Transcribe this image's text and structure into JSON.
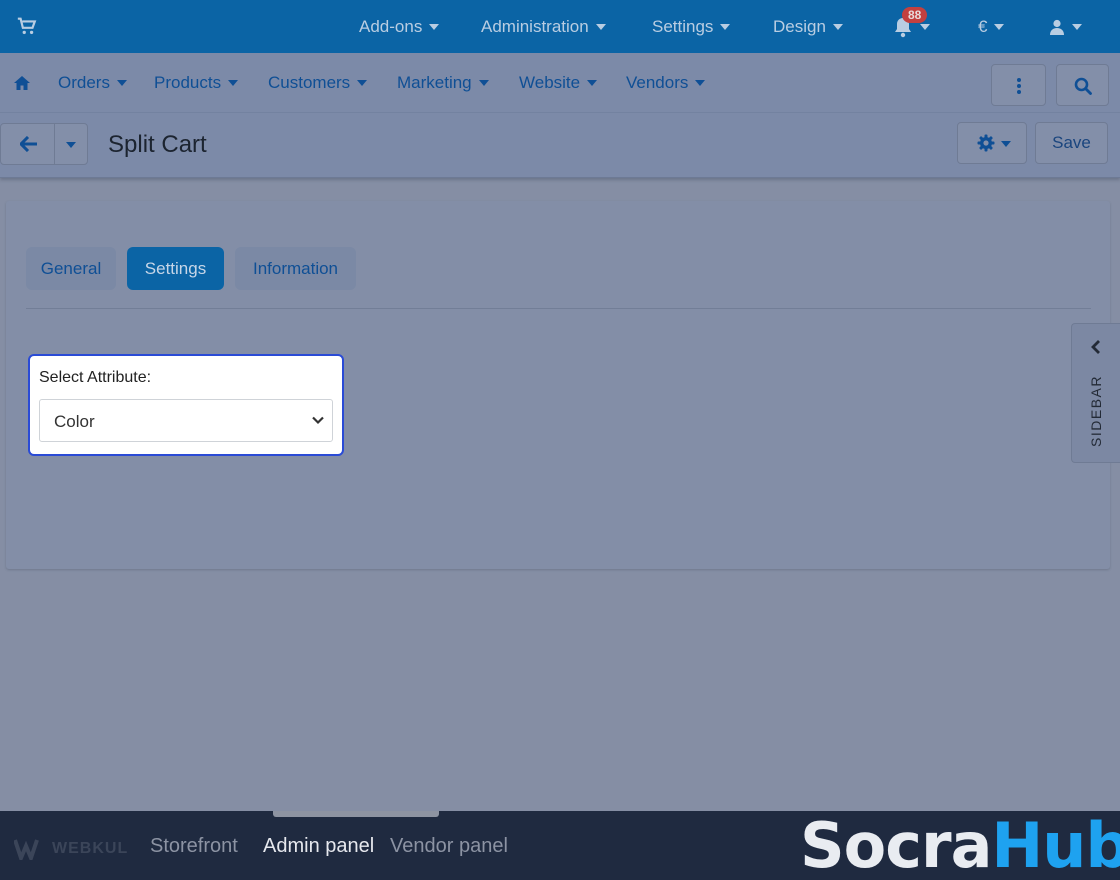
{
  "topbar": {
    "items": [
      {
        "label": "Add-ons"
      },
      {
        "label": "Administration"
      },
      {
        "label": "Settings"
      },
      {
        "label": "Design"
      }
    ],
    "notification_count": "88",
    "currency": "€"
  },
  "mainnav": {
    "items": [
      {
        "label": "Orders"
      },
      {
        "label": "Products"
      },
      {
        "label": "Customers"
      },
      {
        "label": "Marketing"
      },
      {
        "label": "Website"
      },
      {
        "label": "Vendors"
      }
    ]
  },
  "titlebar": {
    "title": "Split Cart",
    "save_label": "Save"
  },
  "tabs": [
    {
      "label": "General",
      "active": false
    },
    {
      "label": "Settings",
      "active": true
    },
    {
      "label": "Information",
      "active": false
    }
  ],
  "form": {
    "attribute_label": "Select Attribute:",
    "attribute_value": "Color"
  },
  "sidebar": {
    "label": "SIDEBAR"
  },
  "bottombar": {
    "brand": "WEBKUL",
    "links": [
      {
        "label": "Storefront"
      },
      {
        "label": "Admin panel"
      },
      {
        "label": "Vendor panel"
      }
    ]
  },
  "watermark": {
    "part1": "Socra",
    "part2": "Hub"
  },
  "colors": {
    "primary": "#0b64a5",
    "highlight_border": "#2a4bd6",
    "badge": "#c2403f"
  }
}
